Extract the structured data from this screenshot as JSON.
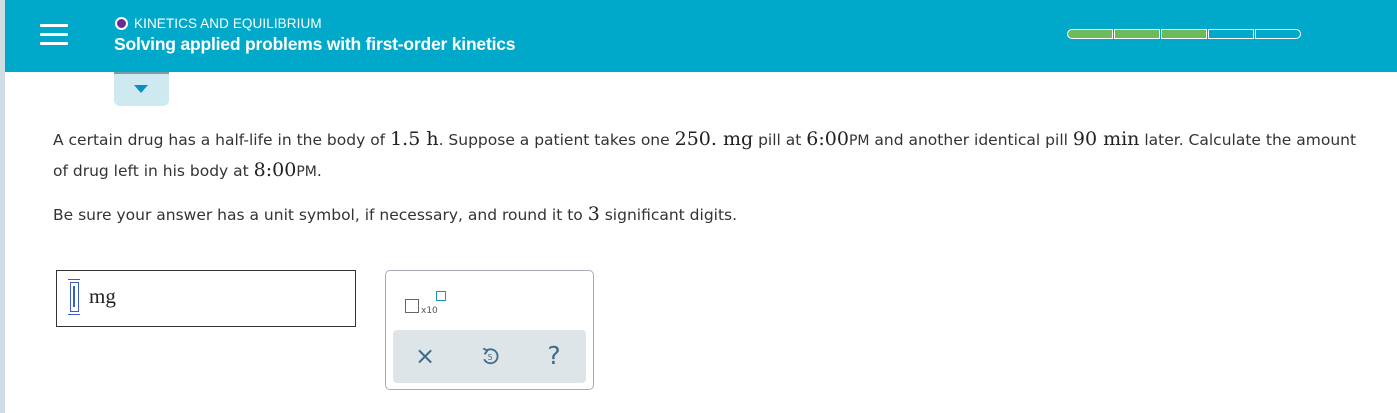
{
  "header": {
    "topic": "KINETICS AND EQUILIBRIUM",
    "title": "Solving applied problems with first-order kinetics",
    "progress_filled": 3,
    "progress_total": 5,
    "colors": {
      "header_bg": "#00a9c9",
      "progress_fill": "#6cbb5a",
      "topic_dot": "#6b2c91"
    }
  },
  "question": {
    "p1": "A certain drug has a half-life in the body of ",
    "half_life": "1.5 h",
    "p2": ". Suppose a patient takes one ",
    "dose": "250. mg",
    "p3": " pill at ",
    "time1": "6:00",
    "time1_suffix": "PM",
    "p4": " and another identical pill ",
    "interval": "90 min",
    "p5": " later. Calculate the amount of drug left in his body at ",
    "time2": "8:00",
    "time2_suffix": "PM",
    "p6": "."
  },
  "instruction": {
    "p1": "Be sure your answer has a unit symbol, if necessary, and round it to ",
    "digits": "3",
    "p2": " significant digits."
  },
  "answer": {
    "value": "",
    "unit": "mg"
  },
  "tools": {
    "x10_label": "x10",
    "clear_icon": "×",
    "undo_icon": "undo-icon",
    "help_icon": "?"
  }
}
